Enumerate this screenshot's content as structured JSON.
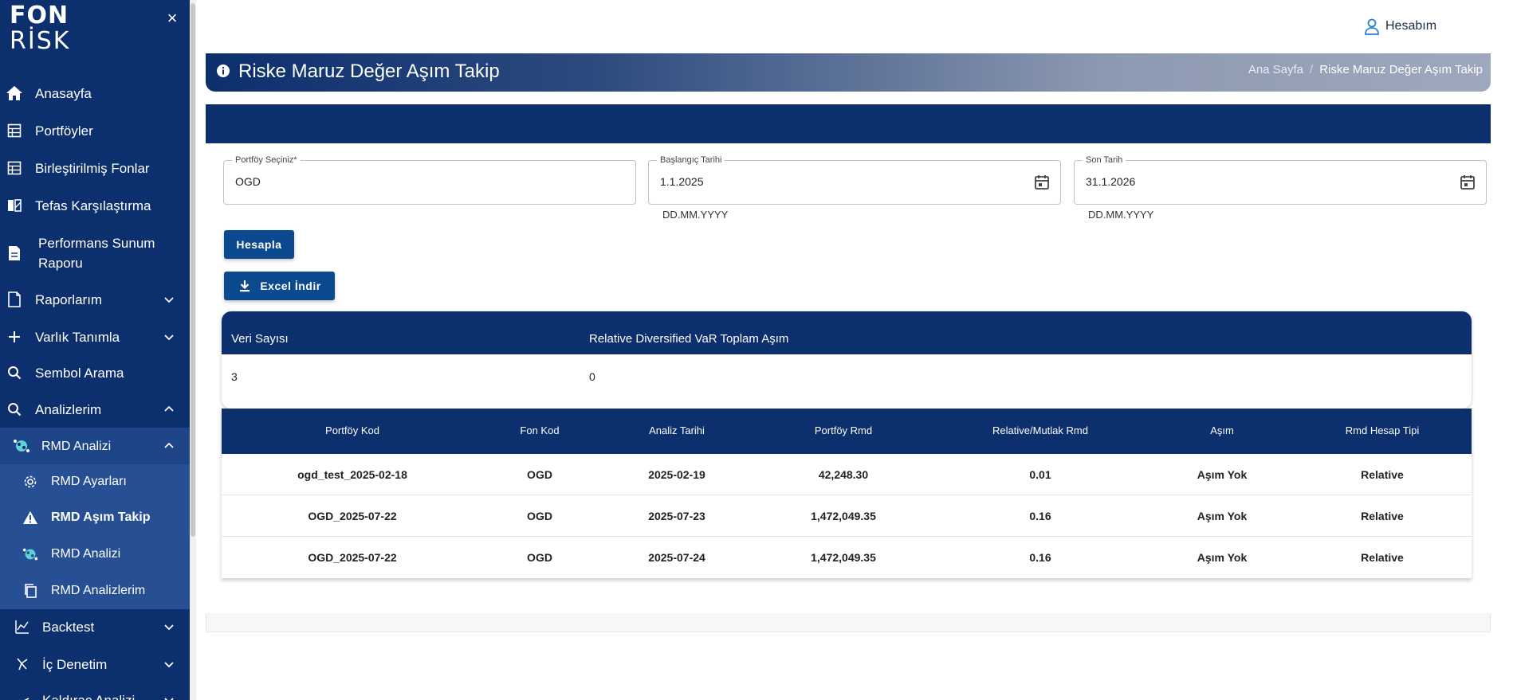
{
  "brand": {
    "line1": "FON",
    "line2": "RİSK"
  },
  "sidebar": {
    "close_symbol": "×",
    "items": [
      {
        "label": "Anasayfa",
        "icon": "home-icon"
      },
      {
        "label": "Portföyler",
        "icon": "table-icon"
      },
      {
        "label": "Birleştirilmiş Fonlar",
        "icon": "table-icon"
      },
      {
        "label": "Tefas Karşılaştırma",
        "icon": "compare-icon"
      },
      {
        "label": "Performans Sunum",
        "label2": "Raporu",
        "icon": "document-icon"
      },
      {
        "label": "Raporlarım",
        "icon": "file-icon"
      },
      {
        "label": "Varlık Tanımla",
        "icon": "plus-icon"
      },
      {
        "label": "Sembol Arama",
        "icon": "search-icon"
      },
      {
        "label": "Analizlerim",
        "icon": "search-icon"
      },
      {
        "label": "RMD Analizi",
        "icon": "brain-icon"
      },
      {
        "label": "RMD Ayarları",
        "icon": "gear-icon"
      },
      {
        "label": "RMD Aşım Takip",
        "icon": "warning-icon"
      },
      {
        "label": "RMD Analizi",
        "icon": "brain-icon"
      },
      {
        "label": "RMD Analizlerim",
        "icon": "copy-icon"
      },
      {
        "label": "Backtest",
        "icon": "chart-icon"
      },
      {
        "label": "İç Denetim",
        "icon": "audit-icon"
      },
      {
        "label": "Kaldıraç Analizi",
        "icon": "lever-icon"
      }
    ]
  },
  "header": {
    "account_label": "Hesabım"
  },
  "page": {
    "title": "Riske Maruz Değer Aşım Takip",
    "breadcrumb": {
      "home": "Ana Sayfa",
      "separator": "/",
      "current": "Riske Maruz Değer Aşım Takip"
    }
  },
  "form": {
    "portfolio": {
      "label": "Portföy Seçiniz*",
      "value": "OGD"
    },
    "start_date": {
      "label": "Başlangıç Tarihi",
      "value": "1.1.2025",
      "hint": "DD.MM.YYYY"
    },
    "end_date": {
      "label": "Son Tarih",
      "value": "31.1.2026",
      "hint": "DD.MM.YYYY"
    },
    "calculate_label": "Hesapla",
    "excel_label": "Excel İndir"
  },
  "summary": {
    "headers": [
      "Veri Sayısı",
      "Relative Diversified VaR Toplam Aşım"
    ],
    "values": [
      "3",
      "0"
    ]
  },
  "table": {
    "headers": [
      "Portföy Kod",
      "Fon Kod",
      "Analiz Tarihi",
      "Portföy Rmd",
      "Relative/Mutlak Rmd",
      "Aşım",
      "Rmd Hesap Tipi"
    ],
    "rows": [
      [
        "ogd_test_2025-02-18",
        "OGD",
        "2025-02-19",
        "42,248.30",
        "0.01",
        "Aşım Yok",
        "Relative"
      ],
      [
        "OGD_2025-07-22",
        "OGD",
        "2025-07-23",
        "1,472,049.35",
        "0.16",
        "Aşım Yok",
        "Relative"
      ],
      [
        "OGD_2025-07-22",
        "OGD",
        "2025-07-24",
        "1,472,049.35",
        "0.16",
        "Aşım Yok",
        "Relative"
      ]
    ]
  },
  "colors": {
    "primary": "#0c2f6e",
    "button": "#0c4a8f",
    "account_icon": "#2a7fd6"
  }
}
